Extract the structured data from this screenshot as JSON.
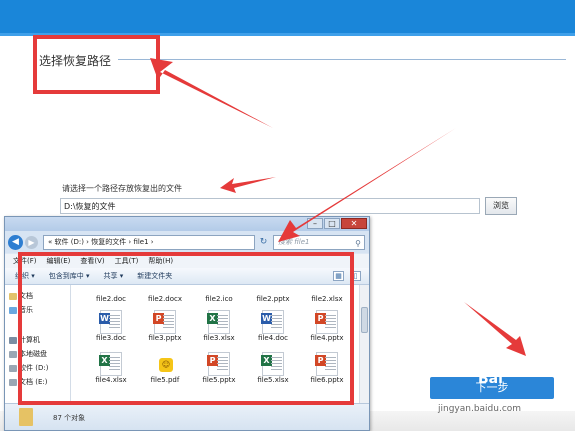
{
  "page": {
    "section_title": "选择恢复路径",
    "prompt": "请选择一个路径存放恢复出的文件",
    "path_value": "D:\\恢复的文件",
    "browse_label": "浏览",
    "next_label": "下一步",
    "watermark": "jingyan.baidu.com",
    "watermark_logo": "Bai"
  },
  "explorer": {
    "breadcrumb": "« 软件 (D:) › 恢复的文件 › file1 ›",
    "search_placeholder": "搜索 file1",
    "menu": [
      "文件(F)",
      "编辑(E)",
      "查看(V)",
      "工具(T)",
      "帮助(H)"
    ],
    "toolbar": [
      "组织 ▾",
      "包含到库中 ▾",
      "共享 ▾",
      "新建文件夹"
    ],
    "nav": [
      "文档",
      "音乐",
      "计算机",
      "本地磁盘",
      "软件 (D:)",
      "文档 (E:)"
    ],
    "row1": [
      "file2.doc",
      "file2.docx",
      "file2.ico",
      "file2.pptx",
      "file2.xlsx"
    ],
    "row2": [
      "file3.doc",
      "file3.pptx",
      "file3.xlsx",
      "file4.doc",
      "file4.pptx"
    ],
    "row3": [
      "file4.xlsx",
      "file5.pdf",
      "file5.pptx",
      "file5.xlsx",
      "file6.pptx"
    ],
    "status": "87 个对象"
  },
  "colors": {
    "accent": "#1a86d9",
    "annotation": "#e53a3a"
  },
  "icons": [
    "back-arrow-icon",
    "forward-arrow-icon",
    "refresh-icon",
    "search-icon",
    "folder-icon"
  ]
}
